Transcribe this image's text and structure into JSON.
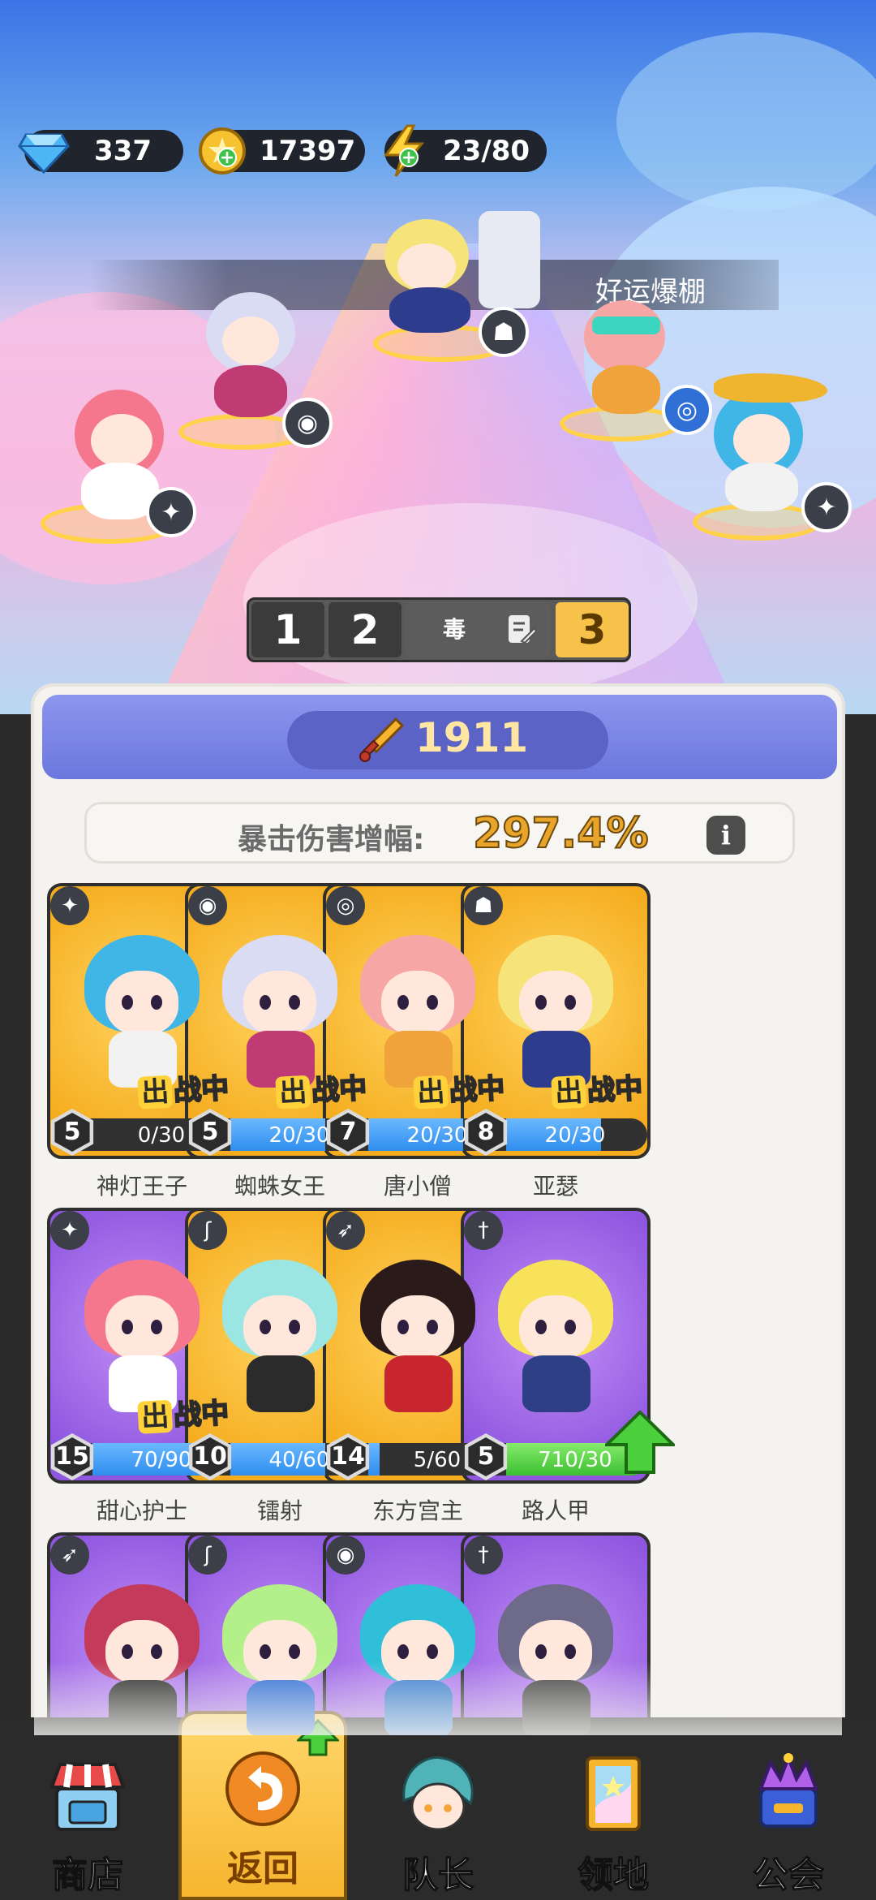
{
  "resources": {
    "gems": "337",
    "gold": "17397",
    "energy": "23/80"
  },
  "banner": {
    "text": "好运爆棚"
  },
  "team_tabs": {
    "tab1": "1",
    "tab2": "2",
    "current_name": "毒",
    "tab3": "3"
  },
  "power": {
    "value": "1911"
  },
  "crit": {
    "label": "暴击伤害增幅:",
    "value": "297.4%"
  },
  "deployed_label": {
    "out": "出",
    "rest": "战中"
  },
  "heroes": [
    {
      "name": "神灯王子",
      "level": "5",
      "progress": "0/30",
      "fill": 0,
      "color": "gold",
      "class_icon": "wings-icon",
      "deployed": true,
      "hair": "#3fb6e6",
      "torso": "#f2f2f2"
    },
    {
      "name": "蜘蛛女王",
      "level": "5",
      "progress": "20/30",
      "fill": 0.67,
      "color": "gold",
      "class_icon": "potion-icon",
      "deployed": true,
      "hair": "#d9dcf2",
      "torso": "#c03a74"
    },
    {
      "name": "唐小僧",
      "level": "7",
      "progress": "20/30",
      "fill": 0.67,
      "color": "gold",
      "class_icon": "spiral-icon",
      "deployed": true,
      "hair": "#f7a6a6",
      "torso": "#f0a33a"
    },
    {
      "name": "亚瑟",
      "level": "8",
      "progress": "20/30",
      "fill": 0.67,
      "color": "gold",
      "class_icon": "helmet-icon",
      "deployed": true,
      "hair": "#f6e37a",
      "torso": "#2d3c8c"
    },
    {
      "name": "甜心护士",
      "level": "15",
      "progress": "70/90",
      "fill": 0.78,
      "color": "purple",
      "class_icon": "wings-icon",
      "deployed": true,
      "hair": "#f4778e",
      "torso": "#ffffff"
    },
    {
      "name": "镭射",
      "level": "10",
      "progress": "40/60",
      "fill": 0.67,
      "color": "gold",
      "class_icon": "hook-icon",
      "deployed": false,
      "hair": "#9be6e3",
      "torso": "#2b2b2b"
    },
    {
      "name": "东方宫主",
      "level": "14",
      "progress": "5/60",
      "fill": 0.08,
      "color": "gold",
      "class_icon": "bow-icon",
      "deployed": false,
      "hair": "#2b1a1a",
      "torso": "#c7262e"
    },
    {
      "name": "路人甲",
      "level": "5",
      "progress": "710/30",
      "fill": 1,
      "color": "purple",
      "class_icon": "sword-icon",
      "deployed": false,
      "hair": "#f7e25a",
      "torso": "#2f3f86",
      "upgrade": true
    },
    {
      "name": "",
      "level": "",
      "progress": "",
      "fill": 0,
      "color": "purple",
      "class_icon": "bow-icon",
      "deployed": false,
      "hair": "#c43a5a",
      "torso": "#2b2b2b"
    },
    {
      "name": "",
      "level": "",
      "progress": "",
      "fill": 0,
      "color": "purple",
      "class_icon": "hook-icon",
      "deployed": false,
      "hair": "#b4f08a",
      "torso": "#2f6fd6"
    },
    {
      "name": "",
      "level": "",
      "progress": "",
      "fill": 0,
      "color": "purple",
      "class_icon": "potion-icon",
      "deployed": false,
      "hair": "#2fbfd8",
      "torso": "#3a7fd0"
    },
    {
      "name": "",
      "level": "",
      "progress": "",
      "fill": 0,
      "color": "purple",
      "class_icon": "sword-icon",
      "deployed": false,
      "hair": "#6d6a8a",
      "torso": "#444"
    }
  ],
  "nav": {
    "shop": "商店",
    "back": "返回",
    "captain": "队长",
    "territory": "领地",
    "guild": "公会"
  },
  "colors": {
    "accent_gold": "#f6b52e",
    "panel_bg": "#f4f3f0",
    "power_bar": "#7a84e6",
    "progress_blue": "#2f8dee",
    "progress_green": "#3bbf32"
  }
}
